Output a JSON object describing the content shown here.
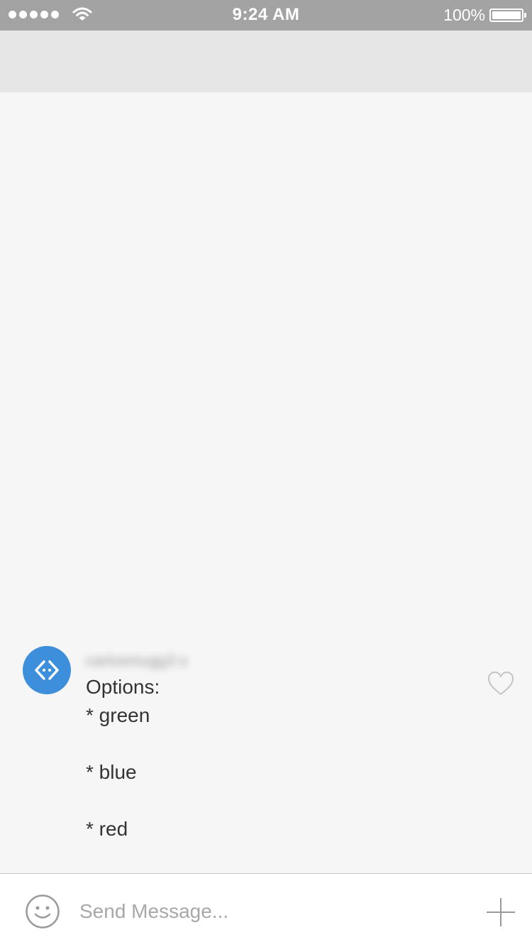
{
  "status_bar": {
    "time": "9:24 AM",
    "battery_percent": "100%",
    "signal_icon": "signal-dots-icon",
    "wifi_icon": "wifi-icon",
    "battery_icon": "battery-icon",
    "battery_level": 1.0
  },
  "nav_bar": {},
  "message": {
    "avatar_icon": "code-brackets-icon",
    "avatar_color": "#3d8fdc",
    "sender_name": "carlosmugg3.s",
    "text": "Options:\n* green\n\n* blue\n\n* red",
    "like_icon": "heart-icon"
  },
  "composer": {
    "emoji_icon": "smiley-icon",
    "placeholder": "Send Message...",
    "value": "",
    "add_icon": "plus-icon"
  },
  "colors": {
    "status_bar_bg": "#a3a3a3",
    "nav_bar_bg": "#e6e6e6",
    "content_bg": "#f6f6f6",
    "composer_bg": "#ffffff",
    "accent": "#3d8fdc"
  }
}
